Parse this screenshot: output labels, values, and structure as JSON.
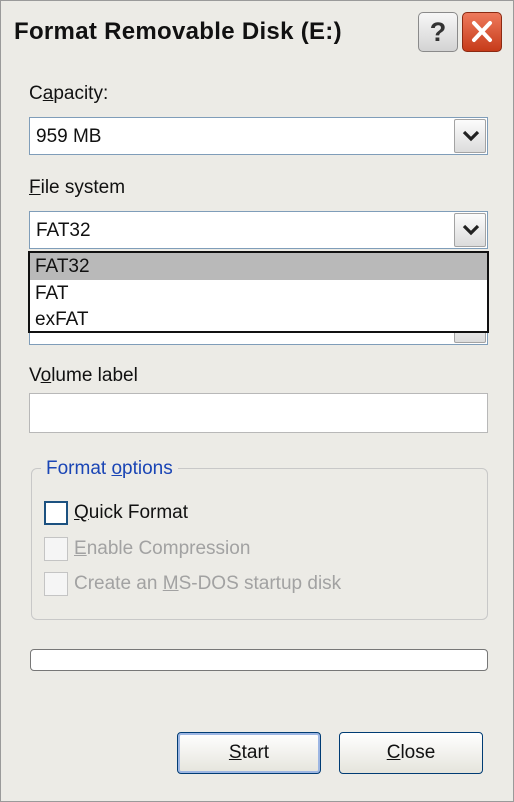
{
  "window": {
    "title": "Format Removable Disk (E:)",
    "help_glyph": "?",
    "close_icon": "close-x-icon"
  },
  "capacity": {
    "label_pre": "C",
    "label_ul": "a",
    "label_post": "pacity:",
    "value": "959 MB"
  },
  "file_system": {
    "label_ul": "F",
    "label_post": "ile system",
    "value": "FAT32",
    "options": [
      "FAT32",
      "FAT",
      "exFAT"
    ],
    "highlighted_option": "FAT32"
  },
  "volume_label": {
    "label_pre": "V",
    "label_ul": "o",
    "label_post": "lume label",
    "value": ""
  },
  "format_options": {
    "title_pre": "Format ",
    "title_ul": "o",
    "title_post": "ptions",
    "quick_format": {
      "label_ul": "Q",
      "label_post": "uick Format",
      "checked": false,
      "enabled": true
    },
    "enable_compression": {
      "label_ul": "E",
      "label_post": "nable Compression",
      "checked": false,
      "enabled": false
    },
    "msdos_startup": {
      "label_pre": "Create an ",
      "label_ul": "M",
      "label_post": "S-DOS startup disk",
      "checked": false,
      "enabled": false
    }
  },
  "progress": {
    "fraction": 0
  },
  "buttons": {
    "start": {
      "label_ul": "S",
      "label_post": "tart"
    },
    "close": {
      "label_ul": "C",
      "label_post": "lose"
    }
  },
  "colors": {
    "dialog_bg": "#ecebe6",
    "group_title": "#1a45b5",
    "close_button": "#c63b1a",
    "selected_option_bg": "#b9b9b9"
  }
}
